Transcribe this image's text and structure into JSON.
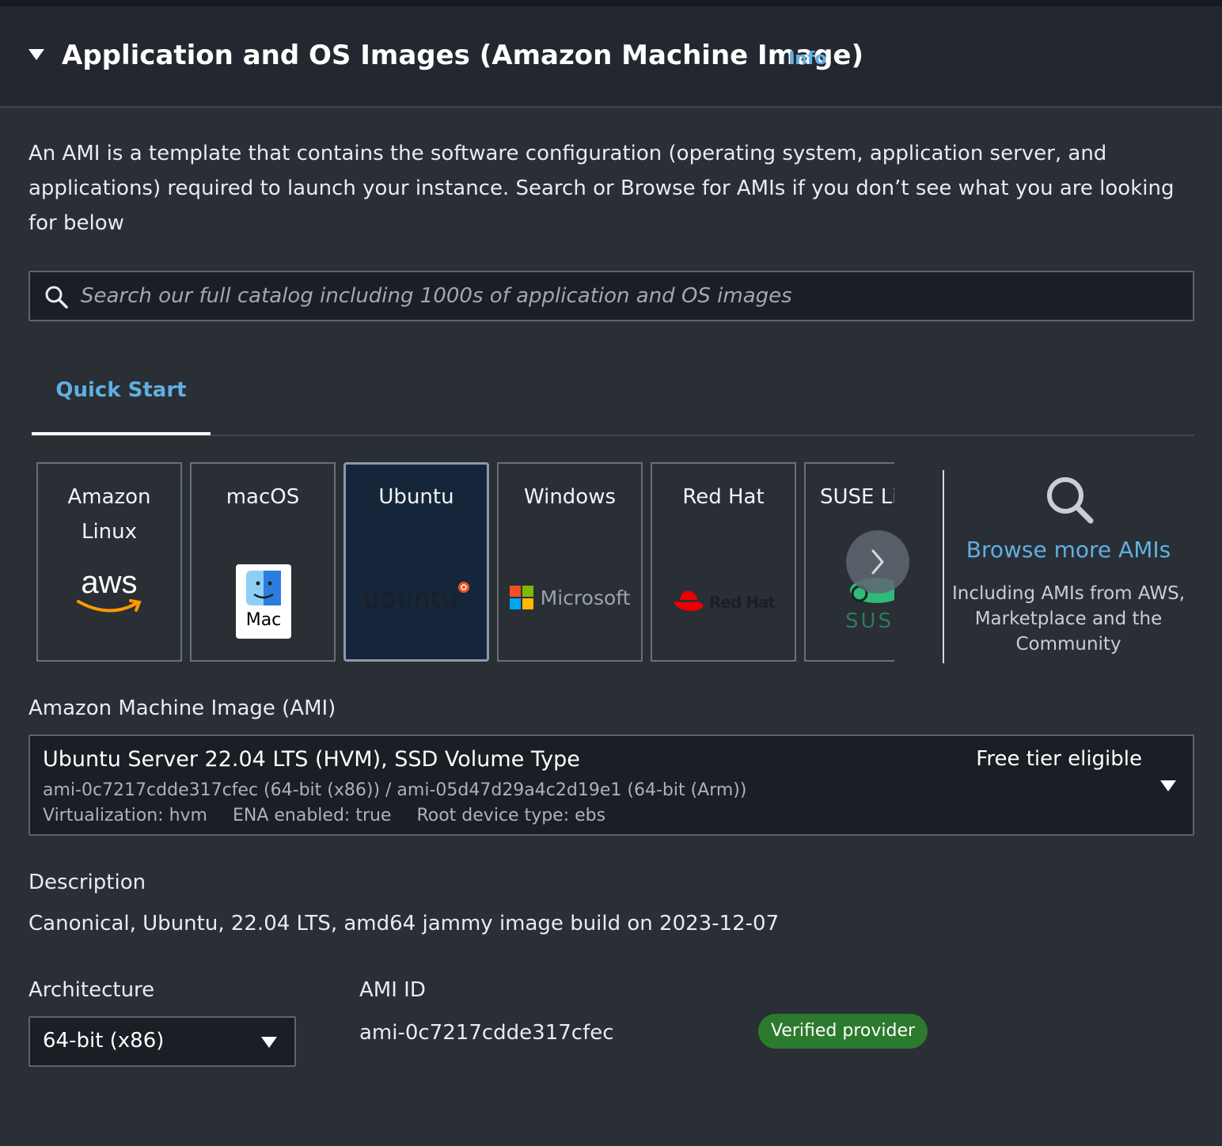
{
  "header": {
    "title": "Application and OS Images (Amazon Machine Image)",
    "info_link": "Info"
  },
  "intro_text": "An AMI is a template that contains the software configuration (operating system, application server, and applications) required to launch your instance. Search or Browse for AMIs if you don’t see what you are looking for below",
  "search": {
    "placeholder": "Search our full catalog including 1000s of application and OS images",
    "icon": "search-icon"
  },
  "tabs": [
    {
      "label": "Quick Start",
      "selected": true
    }
  ],
  "quick_start": {
    "tiles": [
      {
        "label": "Amazon Linux",
        "logo_text": "aws",
        "selected": false
      },
      {
        "label": "macOS",
        "logo_text": "Mac",
        "selected": false
      },
      {
        "label": "Ubuntu",
        "logo_text": "ubuntu",
        "selected": true
      },
      {
        "label": "Windows",
        "logo_text": "Microsoft",
        "selected": false
      },
      {
        "label": "Red Hat",
        "logo_text": "Red Hat",
        "selected": false
      },
      {
        "label": "SUSE Li",
        "logo_text": "SUS",
        "selected": false
      }
    ],
    "next_icon": "chevron-right-icon",
    "browse": {
      "link": "Browse more AMIs",
      "subtext": "Including AMIs from AWS, Marketplace and the Community",
      "icon": "search-icon"
    }
  },
  "ami": {
    "label": "Amazon Machine Image (AMI)",
    "name": "Ubuntu Server 22.04 LTS (HVM), SSD Volume Type",
    "ids": "ami-0c7217cdde317cfec (64-bit (x86)) / ami-05d47d29a4c2d19e1 (64-bit (Arm))",
    "virtualization": "Virtualization: hvm",
    "ena": "ENA enabled: true",
    "root_device": "Root device type: ebs",
    "free_tier": "Free tier eligible"
  },
  "description": {
    "label": "Description",
    "value": "Canonical, Ubuntu, 22.04 LTS, amd64 jammy image build on 2023-12-07"
  },
  "architecture": {
    "label": "Architecture",
    "value": "64-bit (x86)"
  },
  "ami_id": {
    "label": "AMI ID",
    "value": "ami-0c7217cdde317cfec",
    "badge": "Verified provider"
  },
  "colors": {
    "link": "#5fb0e1",
    "badge": "#2c7a2e",
    "selected_tile": "#16263a",
    "background": "#2a2e35"
  }
}
